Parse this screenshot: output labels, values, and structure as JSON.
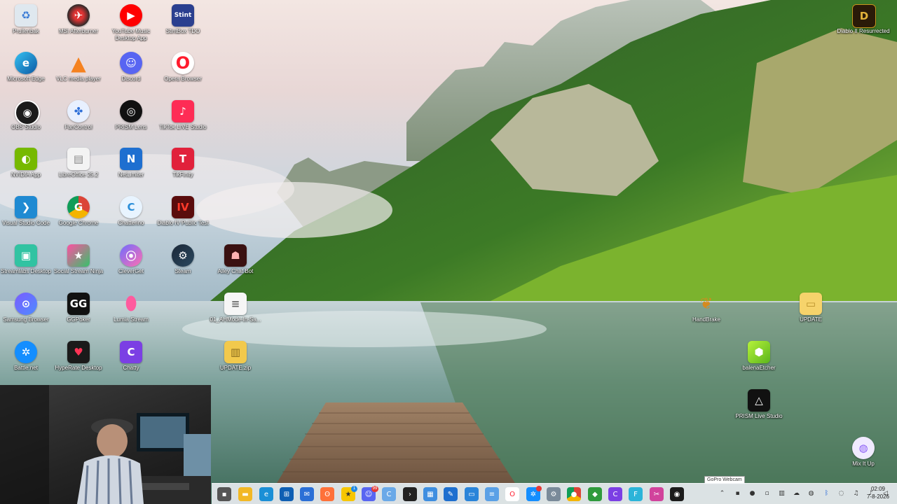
{
  "desktop_icons": {
    "prullenbak": "Prullenbak",
    "msi_afterburner": "MSI Afterburner",
    "youtube_music": "YouTube Music Desktop App",
    "stintbox": "StintBox TDO",
    "edge": "Microsoft Edge",
    "vlc": "VLC media player",
    "discord": "Discord",
    "opera": "Opera Browser",
    "obs": "OBS Studio",
    "fancontrol": "FanControl",
    "prism_lens": "PRISM Lens",
    "tiktok_live": "TikTok LIVE Studio",
    "nvidia": "NVIDIA App",
    "libreoffice": "LibreOffice 25.2",
    "netlimiter": "NetLimiter",
    "tikfinity": "TikFinity",
    "vscode": "Visual Studio Code",
    "chrome": "Google Chrome",
    "chatterino": "Chatterino",
    "diablo4": "Diablo IV Public Test",
    "streamlabs": "Streamlabs Desktop",
    "social_ninja": "Social Stream Ninja",
    "cleverget": "CleverGet",
    "steam": "Steam",
    "alley_bot": "Alley Chat Bot",
    "samsung": "Samsung Browser",
    "ggpoker": "GGPoker",
    "lumia": "Lumia Stream",
    "ahmode": "01_AHMode-In-Sa...",
    "battlenet": "Battle.net",
    "hyperate": "HypeRate Desktop",
    "chatty": "Chatty",
    "update_zip": "UPDATE.zip",
    "diablo2": "Diablo II Resurrected",
    "handbrake": "HandBrake",
    "update": "UPDATE",
    "balena": "balenaEtcher",
    "prism_live": "PRISM Live Studio",
    "mixitup": "Mix It Up"
  },
  "icon_glyphs": {
    "stintbox": "Stint",
    "ggpoker": "GG",
    "chatty": "C",
    "tikfinity": "T",
    "diablo2": "D",
    "diablo4": "IV",
    "opera": "O",
    "netlimiter": "N",
    "chrome": "G"
  },
  "taskbar": {
    "tooltip": "GoPro Webcam",
    "clock_time": "02:09",
    "clock_date": "7-8-2026",
    "badge_1": "1",
    "badge_99": "99"
  },
  "colors": {
    "taskbar_bg": "#e8ecf0",
    "label_text": "#ffffff"
  }
}
